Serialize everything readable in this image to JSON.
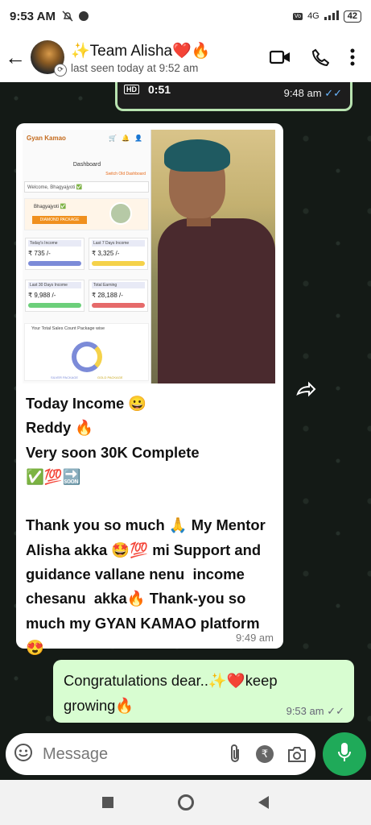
{
  "status": {
    "time": "9:53 AM",
    "network": "4G",
    "battery": "42"
  },
  "header": {
    "title": "✨Team Alisha❤️🔥",
    "subtitle": "last seen today at 9:52 am"
  },
  "top_video": {
    "hd": "HD",
    "duration": "0:51",
    "time": "9:48 am"
  },
  "dashboard": {
    "logo": "Gyan Kamao",
    "title": "Dashboard",
    "switch": "Switch Old Dashboard",
    "welcome": "Welcome, Bhagyajyoti ✅",
    "profile_name": "Bhagyajyoti ✅",
    "package": "DIAMOND PACKAGE",
    "cards": [
      {
        "label": "Today's Income",
        "value": "₹ 735 /-"
      },
      {
        "label": "Last 7 Days Income",
        "value": "₹ 3,325 /-"
      },
      {
        "label": "Last 30 Days Income",
        "value": "₹ 9,988 /-"
      },
      {
        "label": "Total Earning",
        "value": "₹ 28,188 /-"
      }
    ],
    "sales_title": "Your Total Sales Count Package wise",
    "legend": [
      "SILVER PACKAGE",
      "GOLD PACKAGE"
    ]
  },
  "message": {
    "text": "Today Income 😀\nReddy 🔥\nVery soon 30K Complete\n✅💯🔜\n\nThank you so much 🙏 My Mentor Alisha akka 🤩💯 mi Support and guidance vallane nenu  income chesanu  akka🔥 Thank-you so much my GYAN KAMAO platform 😍",
    "time": "9:49 am"
  },
  "outgoing": {
    "text": "Congratulations dear..✨❤️keep growing🔥",
    "time": "9:53 am"
  },
  "input": {
    "placeholder": "Message",
    "rupee": "₹"
  }
}
